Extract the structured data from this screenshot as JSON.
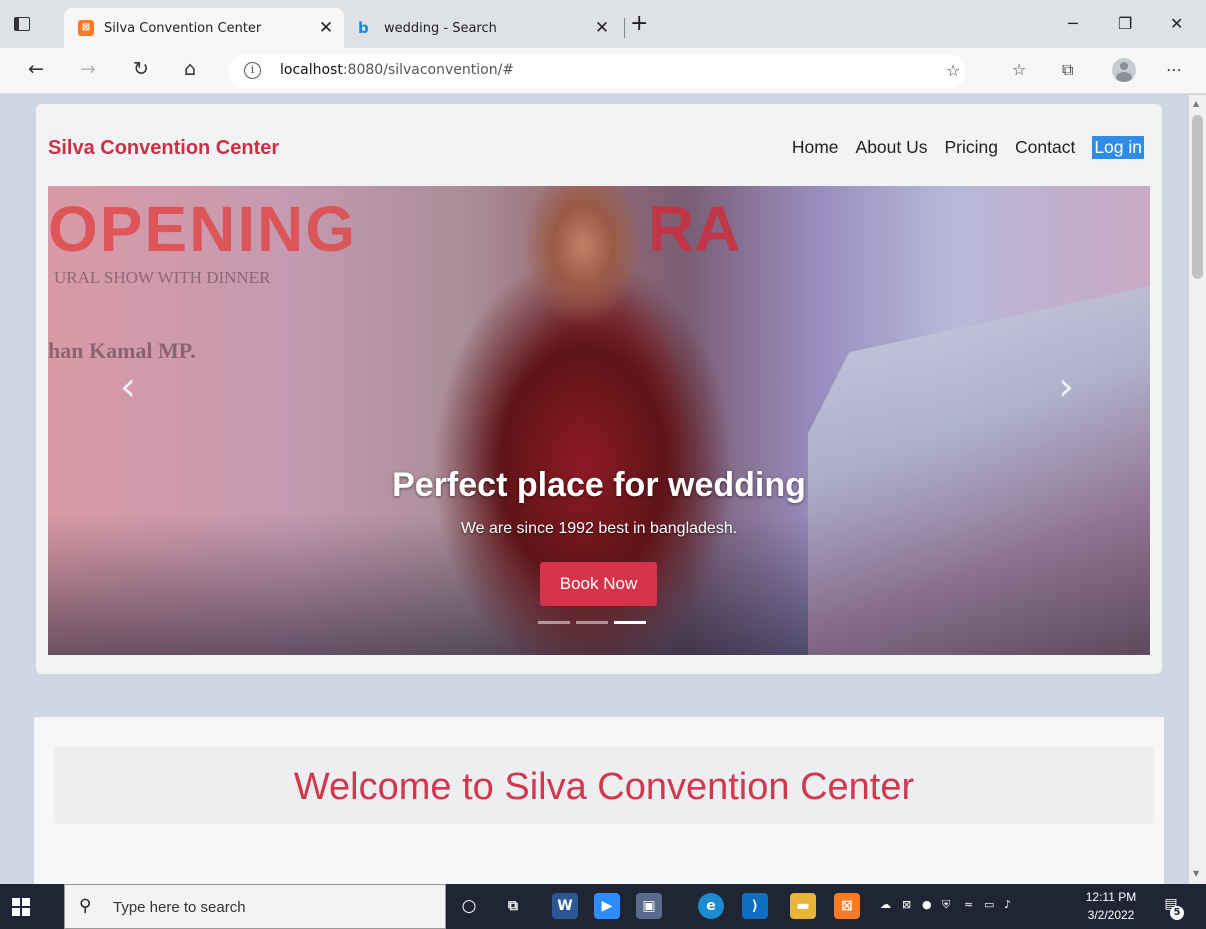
{
  "browser": {
    "tabs": [
      {
        "title": "Silva Convention Center",
        "favicon": "xampp-icon",
        "active": true
      },
      {
        "title": "wedding - Search",
        "favicon": "bing-icon",
        "active": false
      }
    ],
    "url_host": "localhost",
    "url_rest": ":8080/silvaconvention/#"
  },
  "site": {
    "brand": "Silva Convention Center",
    "nav": [
      "Home",
      "About Us",
      "Pricing",
      "Contact"
    ],
    "login": "Log in",
    "hero": {
      "title": "Perfect place for wedding",
      "subtitle": "We are since 1992 best in bangladesh.",
      "button": "Book Now",
      "slide_count": 3,
      "active_slide": 3,
      "bg_text": {
        "opening": "OPENING",
        "show": "URAL SHOW WITH DINNER",
        "name": "han Kamal MP.",
        "brand_partial": "RA"
      }
    },
    "welcome": "Welcome to Silva Convention Center"
  },
  "taskbar": {
    "search_placeholder": "Type here to search",
    "time": "12:11 PM",
    "date": "3/2/2022",
    "notifications": "5"
  },
  "colors": {
    "brand": "#cf2f45",
    "accent_button": "#d6334a",
    "login_bg": "#2f8de8"
  }
}
